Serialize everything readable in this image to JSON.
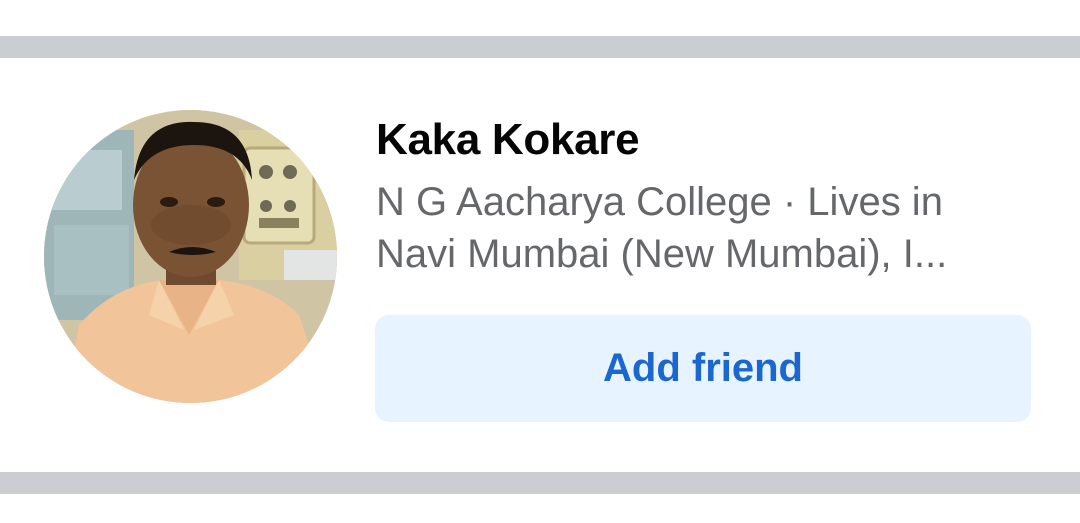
{
  "card": {
    "name": "Kaka Kokare",
    "subtitle_line1": "N G Aacharya College · Lives in",
    "subtitle_line2": "Navi Mumbai (New Mumbai), I...",
    "add_friend_label": "Add friend",
    "avatar_icon": "profile-photo"
  },
  "colors": {
    "divider": "#cacdd1",
    "name": "#050505",
    "subtitle": "#65676b",
    "button_bg": "#e7f3ff",
    "button_text": "#1b67cf"
  }
}
